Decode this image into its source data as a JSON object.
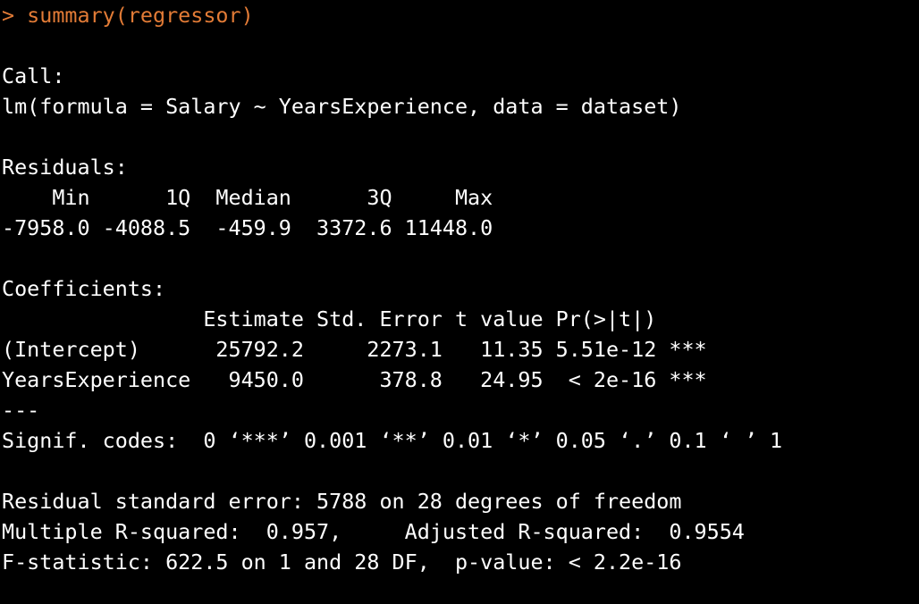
{
  "console": {
    "colors": {
      "background": "#000000",
      "output_text": "#ffffff",
      "command_text": "#e27b36"
    },
    "lines": [
      "> summary(regressor)",
      "",
      "Call:",
      "lm(formula = Salary ~ YearsExperience, data = dataset)",
      "",
      "Residuals:",
      "    Min      1Q  Median      3Q     Max ",
      "-7958.0 -4088.5  -459.9  3372.6 11448.0 ",
      "",
      "Coefficients:",
      "                Estimate Std. Error t value Pr(>|t|)    ",
      "(Intercept)      25792.2     2273.1   11.35 5.51e-12 ***",
      "YearsExperience   9450.0      378.8   24.95  < 2e-16 ***",
      "---",
      "Signif. codes:  0 ‘***’ 0.001 ‘**’ 0.01 ‘*’ 0.05 ‘.’ 0.1 ‘ ’ 1",
      "",
      "Residual standard error: 5788 on 28 degrees of freedom",
      "Multiple R-squared:  0.957,\tAdjusted R-squared:  0.9554 ",
      "F-statistic: 622.5 on 1 and 28 DF,  p-value: < 2.2e-16"
    ]
  }
}
